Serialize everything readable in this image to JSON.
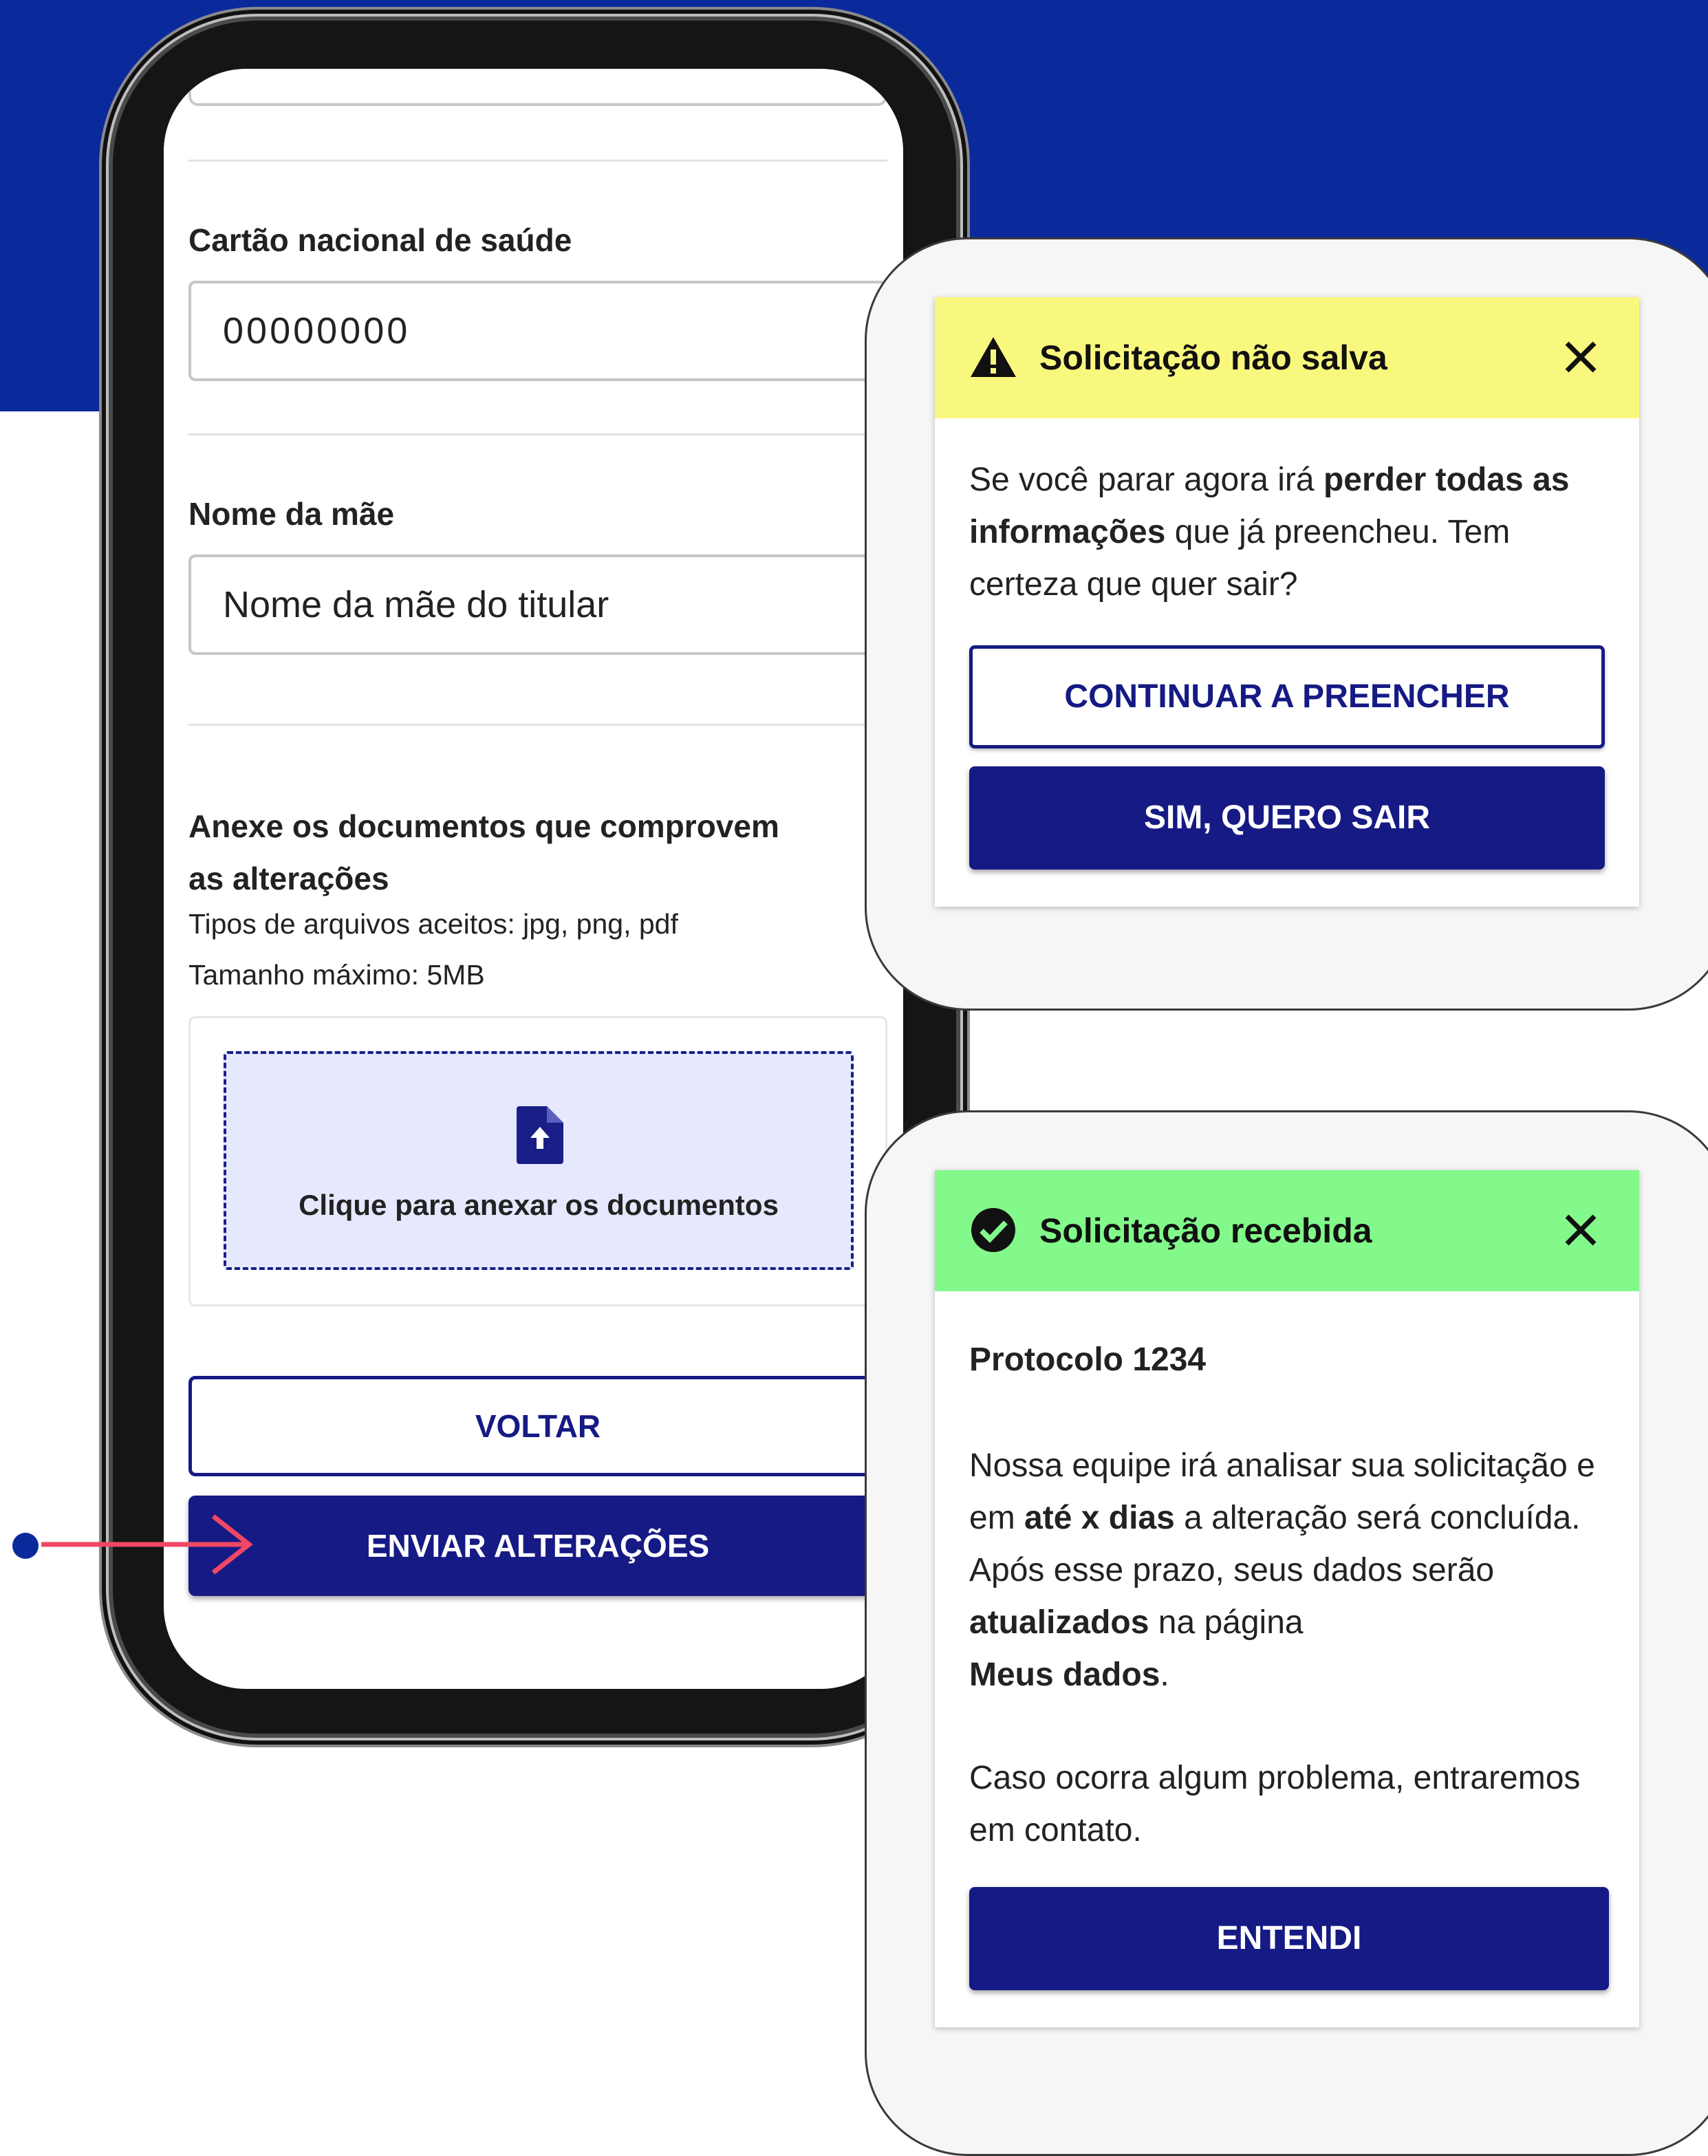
{
  "colors": {
    "brand_blue": "#0a2a9c",
    "primary": "#161a84",
    "warning": "#f9f87e",
    "success": "#82f98a",
    "arrow": "#f04864"
  },
  "form": {
    "card_label": "Cartão nacional de saúde",
    "card_value": "00000000",
    "mother_label": "Nome da mãe",
    "mother_value": "Nome da mãe do titular",
    "attach_title": "Anexe os documentos que comprovem as alterações",
    "file_types": "Tipos de arquivos aceitos: jpg, png, pdf",
    "max_size": "Tamanho máximo: 5MB",
    "upload_text": "Clique para anexar os documentos",
    "upload_icon": "file-upload-icon",
    "back_label": "VOLTAR",
    "submit_label": "ENVIAR ALTERAÇÕES"
  },
  "dialog_unsaved": {
    "icon": "warning-icon",
    "title": "Solicitação não salva",
    "close_icon": "close-icon",
    "body_1": "Se você parar agora irá ",
    "body_bold": "perder todas as informações",
    "body_2": " que já preencheu. Tem certeza que quer sair?",
    "continue_label": "CONTINUAR A PREENCHER",
    "exit_label": "SIM, QUERO SAIR"
  },
  "dialog_received": {
    "icon": "check-circle-icon",
    "title": "Solicitação recebida",
    "close_icon": "close-icon",
    "protocol": "Protocolo 1234",
    "p1_a": "Nossa equipe irá analisar sua solicitação e em ",
    "p1_b": "até x dias",
    "p1_c": " a alteração será concluída. Após esse prazo, seus dados serão ",
    "p1_d": "atualizados",
    "p1_e": " na página ",
    "p1_f": "Meus dados",
    "p1_g": ".",
    "p2": "Caso ocorra algum problema, entraremos em contato.",
    "ok_label": "ENTENDI"
  }
}
